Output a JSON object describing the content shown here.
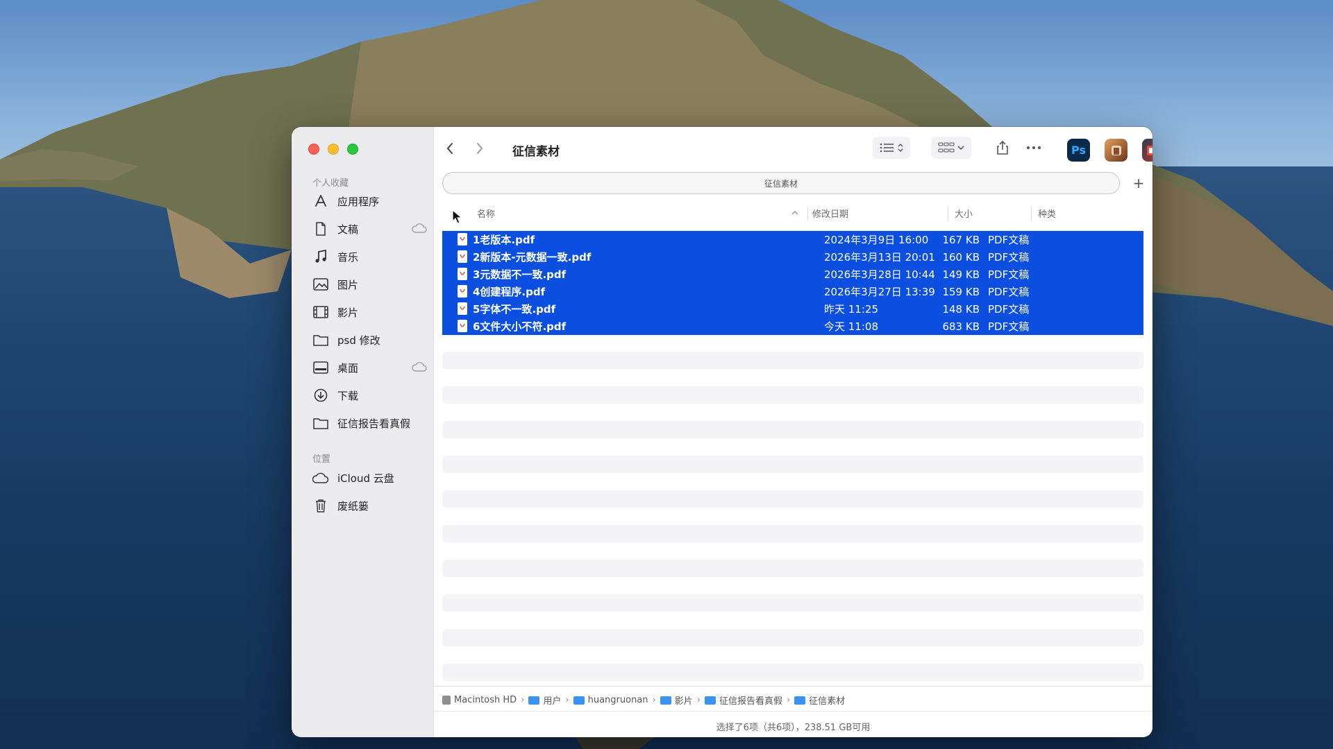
{
  "window": {
    "title": "征信素材"
  },
  "toolbar": {
    "back_label": "‹",
    "forward_label": "›",
    "path_field": "征信素材",
    "apps": [
      {
        "name": "photoshop-app-icon",
        "label": "Ps",
        "color": "#0b2a4a",
        "fg": "#31a8ff"
      },
      {
        "name": "app-icon-2",
        "label": "",
        "color": "#8b4b2e",
        "fg": "#ffffff"
      },
      {
        "name": "app-icon-3",
        "label": "",
        "color": "#c0392b",
        "fg": "#ffffff"
      },
      {
        "name": "app-icon-4",
        "label": "",
        "color": "#1a1f6b",
        "fg": "#6fa6ff"
      },
      {
        "name": "app-icon-5",
        "label": "",
        "color": "#f5b342",
        "fg": "#ffffff"
      }
    ]
  },
  "sidebar": {
    "favorites_heading": "个人收藏",
    "favorites": [
      {
        "label": "应用程序",
        "icon": "applications-icon"
      },
      {
        "label": "文稿",
        "icon": "document-icon",
        "cloud": true
      },
      {
        "label": "音乐",
        "icon": "music-icon"
      },
      {
        "label": "图片",
        "icon": "photo-icon"
      },
      {
        "label": "影片",
        "icon": "film-icon"
      },
      {
        "label": "psd 修改",
        "icon": "folder-icon"
      },
      {
        "label": "桌面",
        "icon": "desktop-icon",
        "cloud": true
      },
      {
        "label": "下载",
        "icon": "download-icon"
      },
      {
        "label": "征信报告看真假",
        "icon": "folder-icon"
      }
    ],
    "locations_heading": "位置",
    "locations": [
      {
        "label": "iCloud 云盘",
        "icon": "icloud-icon"
      },
      {
        "label": "废纸篓",
        "icon": "trash-icon"
      }
    ]
  },
  "columns": {
    "name": "名称",
    "date": "修改日期",
    "size": "大小",
    "kind": "种类"
  },
  "files": [
    {
      "name": "1老版本.pdf",
      "date": "2024年3月9日 16:00",
      "size": "167 KB",
      "kind": "PDF文稿"
    },
    {
      "name": "2新版本-元数据一致.pdf",
      "date": "2026年3月13日 20:01",
      "size": "160 KB",
      "kind": "PDF文稿"
    },
    {
      "name": "3元数据不一致.pdf",
      "date": "2026年3月28日 10:44",
      "size": "149 KB",
      "kind": "PDF文稿"
    },
    {
      "name": "4创建程序.pdf",
      "date": "2026年3月27日 13:39",
      "size": "159 KB",
      "kind": "PDF文稿"
    },
    {
      "name": "5字体不一致.pdf",
      "date": "昨天 11:25",
      "size": "148 KB",
      "kind": "PDF文稿"
    },
    {
      "name": "6文件大小不符.pdf",
      "date": "今天 11:08",
      "size": "683 KB",
      "kind": "PDF文稿"
    }
  ],
  "breadcrumb": [
    "Macintosh HD",
    "用户",
    "huangruonan",
    "影片",
    "征信报告看真假",
    "征信素材"
  ],
  "status": "选择了6项（共6项），238.51 GB可用",
  "colors": {
    "selection": "#0a4fe0",
    "folder": "#3b92f0"
  }
}
